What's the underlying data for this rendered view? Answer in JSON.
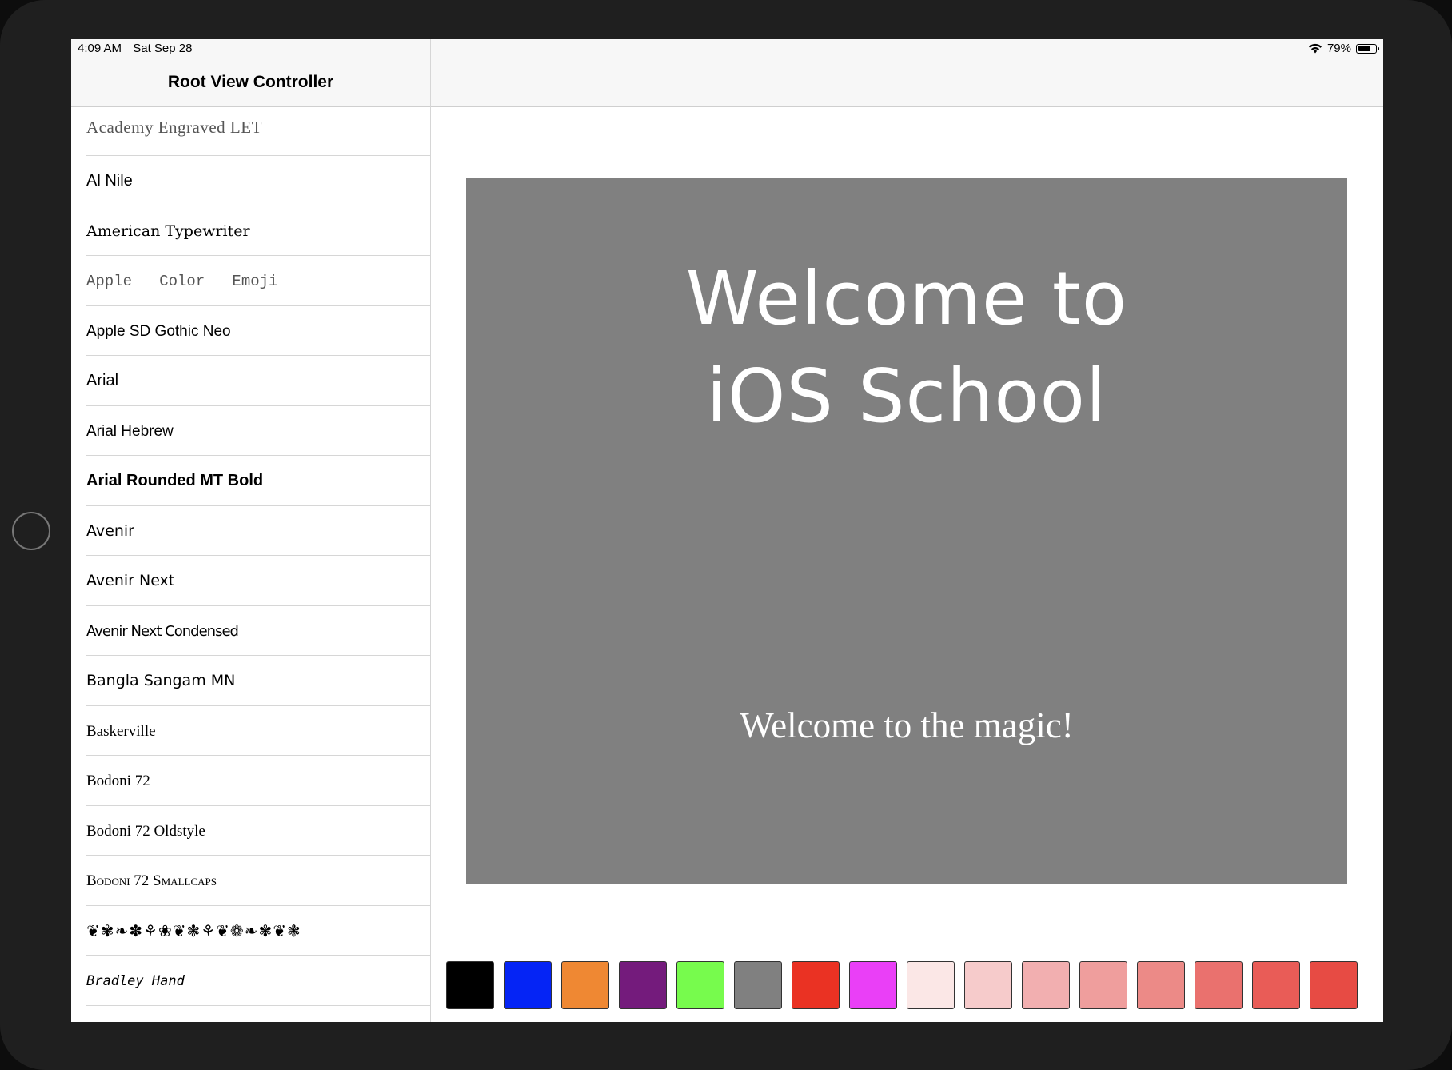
{
  "status_bar": {
    "time": "4:09 AM",
    "date": "Sat Sep 28",
    "battery": "79%",
    "battery_level": 0.79
  },
  "master": {
    "title": "Root View Controller",
    "fonts": [
      {
        "label": "Academy Engraved LET",
        "family": "\"Liberation Serif\", serif",
        "style": "color:#555;letter-spacing:0.5px;font-size:21px;"
      },
      {
        "label": "Al Nile",
        "family": "\"Liberation Sans\", sans-serif",
        "style": ""
      },
      {
        "label": "American Typewriter",
        "family": "\"DejaVu Serif\", serif",
        "style": "font-size:19px;"
      },
      {
        "label": "Apple   Color   Emoji",
        "family": "\"Liberation Mono\", monospace",
        "style": "color:#555;font-size:19px;white-space:pre;"
      },
      {
        "label": "Apple SD Gothic Neo",
        "family": "\"Liberation Sans\", sans-serif",
        "style": "font-size:19px;"
      },
      {
        "label": "Arial",
        "family": "\"Liberation Sans\", sans-serif",
        "style": ""
      },
      {
        "label": "Arial Hebrew",
        "family": "\"Liberation Sans\", sans-serif",
        "style": "font-size:19px;"
      },
      {
        "label": "Arial Rounded MT Bold",
        "family": "\"Liberation Sans\", sans-serif",
        "style": "font-weight:bold;"
      },
      {
        "label": "Avenir",
        "family": "\"DejaVu Sans\", sans-serif",
        "style": "font-size:19px;"
      },
      {
        "label": "Avenir Next",
        "family": "\"DejaVu Sans\", sans-serif",
        "style": "font-size:19px;"
      },
      {
        "label": "Avenir Next Condensed",
        "family": "\"DejaVu Sans\", sans-serif",
        "style": "font-size:18px;letter-spacing:-1px;"
      },
      {
        "label": "Bangla Sangam MN",
        "family": "\"DejaVu Sans\", sans-serif",
        "style": "font-size:19px;"
      },
      {
        "label": "Baskerville",
        "family": "\"Liberation Serif\", serif",
        "style": "font-size:19px;"
      },
      {
        "label": "Bodoni 72",
        "family": "\"Liberation Serif\", serif",
        "style": "font-size:19px;"
      },
      {
        "label": "Bodoni 72 Oldstyle",
        "family": "\"Liberation Serif\", serif",
        "style": "font-size:19px;"
      },
      {
        "label": "Bodoni 72 Smallcaps",
        "family": "\"Liberation Serif\", serif",
        "style": "font-variant:small-caps;font-size:19px;"
      },
      {
        "label": "❦✾❧✽⚘❀❦❃⚘❦❁❧✾❦❃",
        "family": "\"DejaVu Sans\", sans-serif",
        "style": "font-size:20px;letter-spacing:1px;"
      },
      {
        "label": "Bradley Hand",
        "family": "\"DejaVu Sans Mono\", monospace",
        "style": "font-style:italic;font-size:17px;"
      }
    ]
  },
  "preview": {
    "title_line1": "Welcome to",
    "title_line2": "iOS School",
    "subtitle": "Welcome to the magic!",
    "background": "#808080"
  },
  "swatches": [
    "#000000",
    "#0524f5",
    "#ef8833",
    "#741b7c",
    "#77fb4d",
    "#808080",
    "#ea3223",
    "#ea3ff7",
    "#fbe7e6",
    "#f6cbcb",
    "#f2afb0",
    "#ef9e9d",
    "#ec8a87",
    "#ea716e",
    "#e95c57",
    "#e74b44"
  ]
}
